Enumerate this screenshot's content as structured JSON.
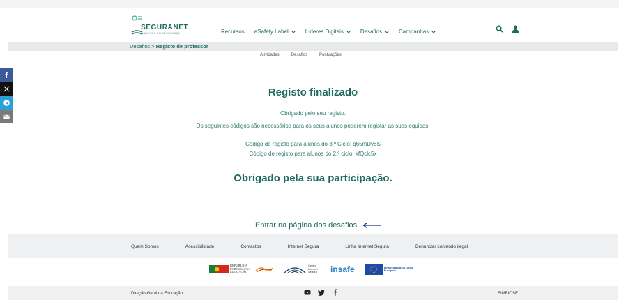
{
  "logo": {
    "name": "SEGURANET",
    "tagline": "NAVEGAR EM SEGURANÇA"
  },
  "nav": {
    "items": [
      {
        "label": "Recursos",
        "dropdown": false
      },
      {
        "label": "eSafety Label",
        "dropdown": true
      },
      {
        "label": "Líderes Digitais",
        "dropdown": true
      },
      {
        "label": "Desafios",
        "dropdown": true
      },
      {
        "label": "Campanhas",
        "dropdown": true
      }
    ]
  },
  "breadcrumb": {
    "parent": "Desafios",
    "separator": ">",
    "current": "Registo de professor"
  },
  "subnav": [
    "Atividades",
    "Desafios",
    "Pontuações"
  ],
  "main": {
    "title": "Registo finalizado",
    "thanks_line": "Obrigado pelo seu registo.",
    "info_line": "Os seguintes códigos são necessários para os seus alunos poderem registar as suas equipas.",
    "code3": "Código de registo para alunos do 3.º Ciclo: q65mDv8S",
    "code2": "Código de registo para alunos do 2.º ciclo: kfQclc5x",
    "participation": "Obrigado pela sua participação.",
    "enter_link": "Entrar na página dos desafios"
  },
  "footer": {
    "links": [
      "Quem Somos",
      "Acessibilidade",
      "Contactos",
      "Internet Segura",
      "Linha Internet Segura",
      "Denunciar conteúdo ilegal"
    ],
    "logos": {
      "republica": "REPÚBLICA PORTUGUESA EDUCAÇÃO",
      "cis": "Centro Internet Segura",
      "insafe": "insafe",
      "eu": "Financiado pela União Europeia"
    },
    "left": "Direção-Geral da Educação",
    "right": "SIMBIOSE"
  },
  "colors": {
    "brand": "#1d6b5f",
    "accent_arrow": "#1a2a8a"
  }
}
